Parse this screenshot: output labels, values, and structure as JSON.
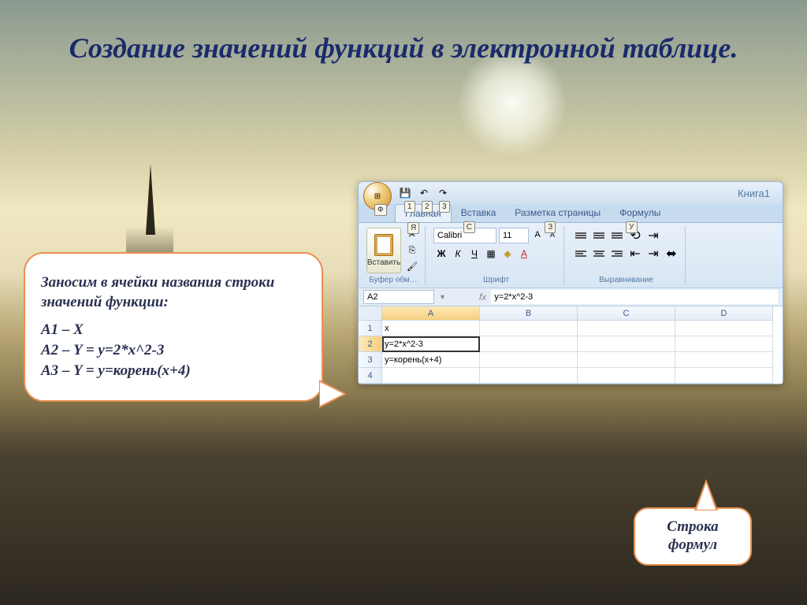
{
  "slide": {
    "title": "Создание значений функций в электронной таблице."
  },
  "callout_left": {
    "heading": "Заносим в ячейки названия строки значений функции:",
    "lines": [
      "А1 – Х",
      "А2 – Y = y=2*x^2-3",
      "А3 – Y = y=корень(x+4)"
    ]
  },
  "callout_bottom": {
    "text": "Строка формул"
  },
  "excel": {
    "doc_title": "Книга1",
    "office_hint": "Ф",
    "qat_hints": [
      "1",
      "2",
      "3"
    ],
    "tabs": [
      {
        "label": "Главная",
        "active": true,
        "hint": "Я"
      },
      {
        "label": "Вставка",
        "active": false,
        "hint": "С"
      },
      {
        "label": "Разметка страницы",
        "active": false,
        "hint": "З"
      },
      {
        "label": "Формулы",
        "active": false,
        "hint": "У"
      }
    ],
    "ribbon": {
      "clipboard_label": "Буфер обм…",
      "paste_label": "Вставить",
      "font_label": "Шрифт",
      "font_name": "Calibri",
      "font_size": "11",
      "align_label": "Выравнивание"
    },
    "name_box": "A2",
    "formula_value": "y=2*x^2-3",
    "columns": [
      "A",
      "B",
      "C",
      "D"
    ],
    "rows": [
      {
        "num": "1",
        "cells": [
          "x",
          "",
          "",
          ""
        ]
      },
      {
        "num": "2",
        "cells": [
          "y=2*x^2-3",
          "",
          "",
          ""
        ],
        "selected": true
      },
      {
        "num": "3",
        "cells": [
          "y=корень(x+4)",
          "",
          "",
          ""
        ]
      },
      {
        "num": "4",
        "cells": [
          "",
          "",
          "",
          ""
        ]
      }
    ]
  }
}
